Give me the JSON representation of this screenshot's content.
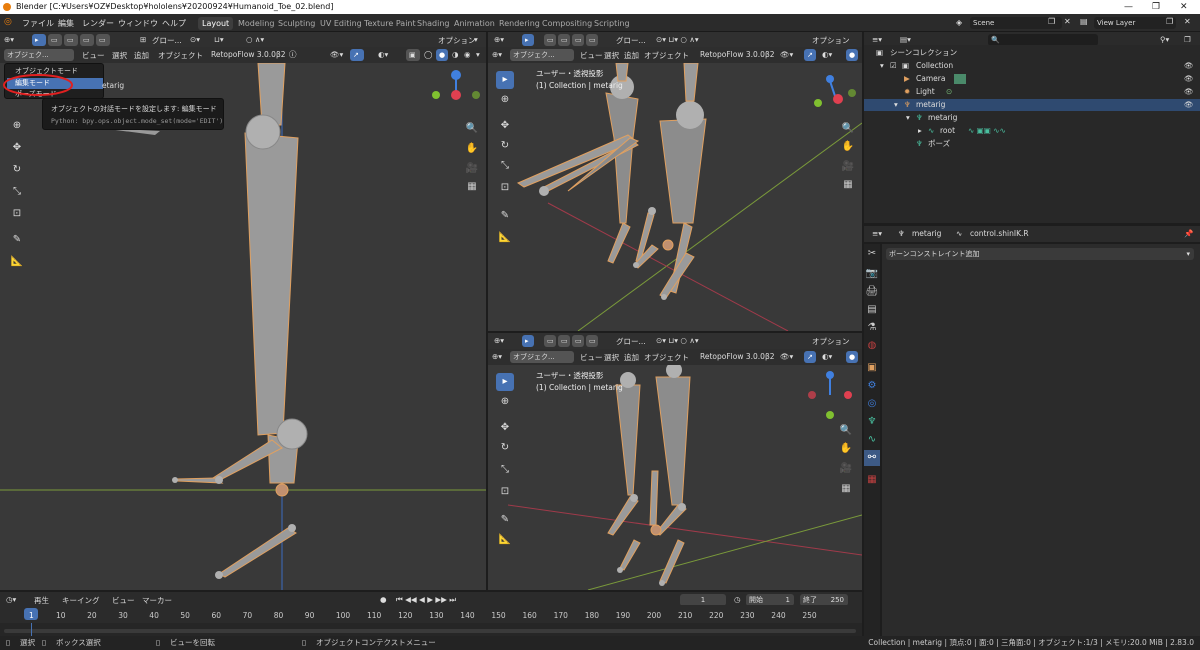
{
  "window": {
    "title": "Blender [C:¥Users¥OZ¥Desktop¥hololens¥20200924¥Humanoid_Toe_02.blend]",
    "min": "—",
    "max": "❐",
    "close": "✕"
  },
  "menu": [
    "ファイル",
    "編集",
    "レンダー",
    "ウィンドウ",
    "ヘルプ"
  ],
  "workspaces": [
    "Layout",
    "Modeling",
    "Sculpting",
    "UV Editing",
    "Texture Paint",
    "Shading",
    "Animation",
    "Rendering",
    "Compositing",
    "Scripting"
  ],
  "active_workspace": "Layout",
  "scene": {
    "label": "Scene",
    "view_layer": "View Layer"
  },
  "viewport_header": {
    "mode_short": "オブジェク...",
    "view": "ビュー",
    "select": "選択",
    "add": "追加",
    "object": "オブジェクト",
    "transform": "グロー...",
    "addon": "RetopoFlow 3.0.0β2",
    "options": "オプション"
  },
  "mode_menu": {
    "items": [
      "オブジェクトモード",
      "編集モード",
      "ポーズモード"
    ],
    "highlighted": "編集モード",
    "behind_text": "etarig"
  },
  "tooltip": {
    "line1": "オブジェクトの対話モードを設定します: 編集モード",
    "line2": "Python: bpy.ops.object.mode_set(mode='EDIT')"
  },
  "viewport_info": {
    "projection": "ユーザー・透視投影",
    "collection": "(1) Collection | metarig"
  },
  "outliner": {
    "search_placeholder": "",
    "rows": [
      {
        "label": "シーンコレクション",
        "indent": 0
      },
      {
        "label": "Collection",
        "indent": 1
      },
      {
        "label": "Camera",
        "indent": 2
      },
      {
        "label": "Light",
        "indent": 2
      },
      {
        "label": "metarig",
        "indent": 2,
        "selected": true
      },
      {
        "label": "metarig",
        "indent": 3
      },
      {
        "label": "root",
        "indent": 4
      },
      {
        "label": "ポーズ",
        "indent": 3
      }
    ]
  },
  "properties": {
    "object": "metarig",
    "bone": "control.shinIK.R",
    "add_constraint": "ボーンコンストレイント追加"
  },
  "timeline": {
    "playback": "再生",
    "keying": "キーイング",
    "view": "ビュー",
    "marker": "マーカー",
    "current_frame": "1",
    "start_label": "開始",
    "start": "1",
    "end_label": "終了",
    "end": "250",
    "ticks": [
      "1",
      "10",
      "20",
      "30",
      "40",
      "50",
      "60",
      "70",
      "80",
      "90",
      "100",
      "110",
      "120",
      "130",
      "140",
      "150",
      "160",
      "170",
      "180",
      "190",
      "200",
      "210",
      "220",
      "230",
      "240",
      "250"
    ]
  },
  "statusbar": {
    "select": "選択",
    "box_select": "ボックス選択",
    "rotate_view": "ビューを回転",
    "context_menu": "オブジェクトコンテクストメニュー",
    "stats": "Collection | metarig | 頂点:0 | 面:0 | 三角面:0 | オブジェクト:1/3 | メモリ:20.0 MiB | 2.83.0"
  },
  "colors": {
    "accent": "#4772b3",
    "bone_fill": "#9a9a9a",
    "bone_outline": "#e0a060",
    "axis_x": "#e04050",
    "axis_y": "#80c030",
    "axis_z": "#4080e0",
    "highlight_circle": "#e02020"
  }
}
